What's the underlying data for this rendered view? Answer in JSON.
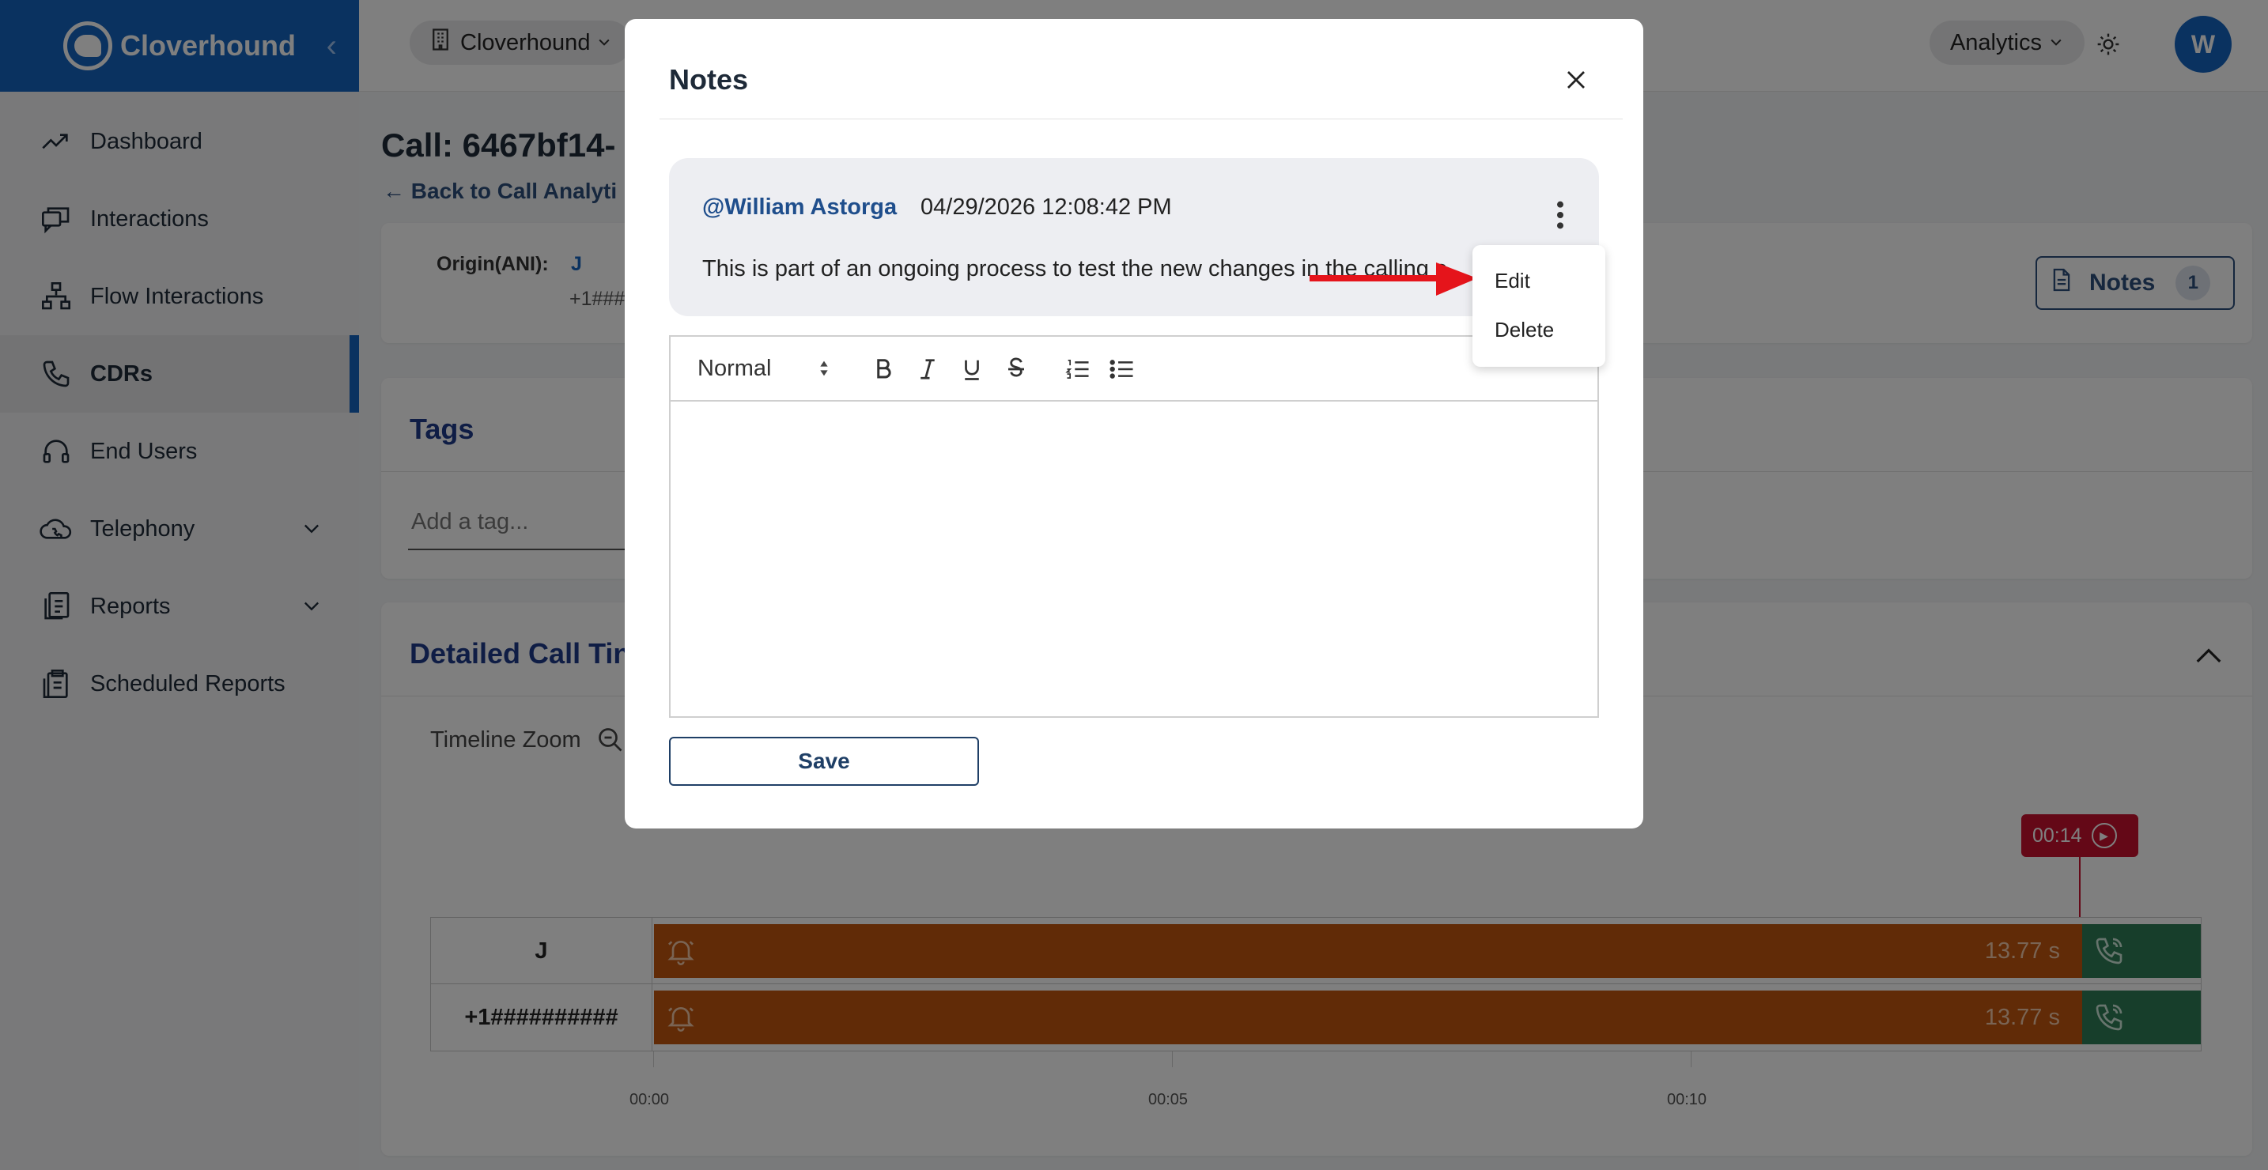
{
  "sidebar": {
    "brand": "Cloverhound",
    "items": [
      {
        "label": "Dashboard",
        "icon": "trend-icon"
      },
      {
        "label": "Interactions",
        "icon": "chat-icon"
      },
      {
        "label": "Flow Interactions",
        "icon": "flow-icon"
      },
      {
        "label": "CDRs",
        "icon": "phone-icon",
        "active": true
      },
      {
        "label": "End Users",
        "icon": "headset-icon"
      },
      {
        "label": "Telephony",
        "icon": "cloud-phone-icon",
        "expandable": true
      },
      {
        "label": "Reports",
        "icon": "report-icon",
        "expandable": true
      },
      {
        "label": "Scheduled Reports",
        "icon": "clipboard-icon"
      }
    ]
  },
  "topbar": {
    "org": "Cloverhound",
    "module": "Analytics",
    "avatar_initial": "W"
  },
  "main": {
    "title": "Call: 6467bf14-",
    "back_link": "Back to Call Analyti",
    "origin_label": "Origin(ANI):",
    "origin_value": "J",
    "origin_sub": "+1###",
    "notes_label": "Notes",
    "notes_count": "1",
    "tags_title": "Tags",
    "tag_placeholder": "Add a tag...",
    "timeline_title": "Detailed Call Tin",
    "zoom_label": "Timeline Zoom",
    "marker_time": "00:14",
    "rows": [
      {
        "name": "J",
        "duration": "13.77 s"
      },
      {
        "name": "+1##########",
        "duration": "13.77 s"
      }
    ],
    "ticks": [
      "00:00",
      "00:05",
      "00:10"
    ]
  },
  "modal": {
    "title": "Notes",
    "note": {
      "author": "@William Astorga",
      "timestamp": "04/29/2026 12:08:42 PM",
      "text": "This is part of an ongoing process to test the new changes in the calling s"
    },
    "menu": {
      "edit": "Edit",
      "delete": "Delete"
    },
    "editor": {
      "format": "Normal"
    },
    "save_label": "Save"
  },
  "colors": {
    "brand": "#1565c0",
    "timeline_bar": "#c2560e",
    "timeline_end": "#2e7d57",
    "marker": "#c8102e",
    "annotation_arrow": "#e5141b"
  }
}
